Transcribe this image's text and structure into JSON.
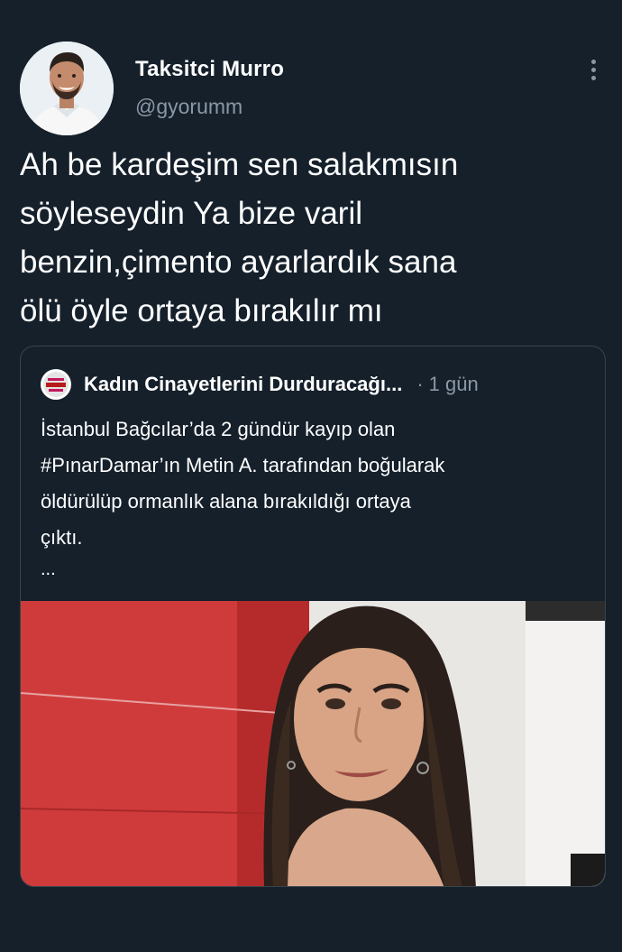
{
  "author": {
    "display_name": "Taksitci Murro",
    "handle": "@gyorumm",
    "avatar_icon": "profile-photo"
  },
  "tweet": {
    "text": "Ah be kardeşim sen salakmısın\nsöyleseydin Ya bize varil\nbenzin,çimento ayarlardık sana\nölü öyle ortaya bırakılır mı"
  },
  "more_icon": "more-vertical-icon",
  "quoted_tweet": {
    "author_name": "Kadın Cinayetlerini Durduracağı...",
    "separator": "·",
    "time": "1 gün",
    "text": "İstanbul Bağcılar’da 2 gündür kayıp olan\n#PınarDamar’ın Metin A. tarafından boğularak\nöldürülüp ormanlık alana bırakıldığı ortaya\nçıktı.",
    "ellipsis": "...",
    "media_icon": "photo-of-woman"
  },
  "colors": {
    "background": "#15202b",
    "text_primary": "#ffffff",
    "text_secondary": "#8b98a5",
    "border": "#38444d"
  }
}
